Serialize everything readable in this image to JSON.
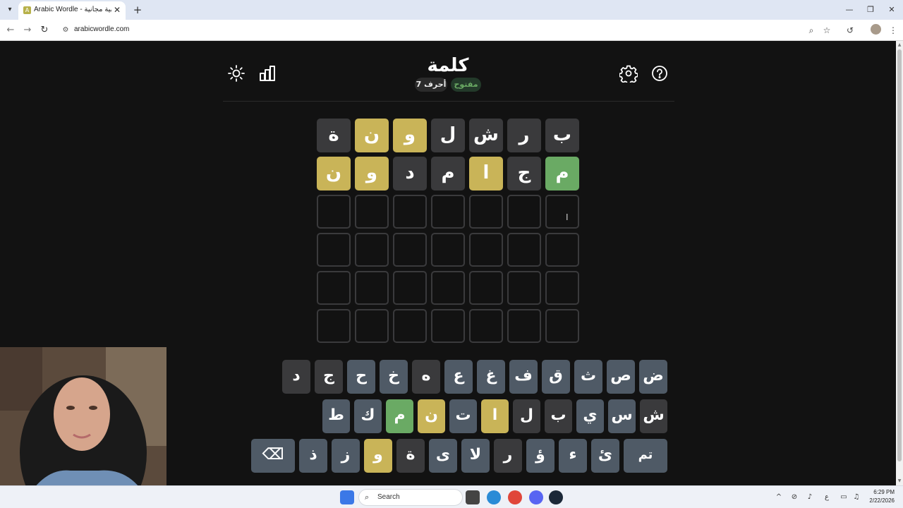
{
  "browser": {
    "tab_title": "Arabic Wordle - كلمة: لعبة كلمات عربية مجانية",
    "url": "arabicwordle.com",
    "icons": [
      "tab-list",
      "close",
      "new-tab",
      "minimize",
      "restore",
      "window-close",
      "back",
      "forward",
      "reload",
      "site-info",
      "zoom",
      "bookmark-star",
      "history",
      "profile",
      "menu"
    ]
  },
  "header": {
    "title": "كلمة",
    "badge_open": "مفتوح",
    "badge_letters": "7 أحرف",
    "icons": [
      "sun-icon",
      "stats-icon",
      "settings-icon",
      "help-icon"
    ]
  },
  "board": {
    "rows": [
      {
        "tiles": [
          {
            "letter": "ب",
            "state": "absent"
          },
          {
            "letter": "ر",
            "state": "absent"
          },
          {
            "letter": "ش",
            "state": "absent"
          },
          {
            "letter": "ل",
            "state": "absent"
          },
          {
            "letter": "و",
            "state": "present"
          },
          {
            "letter": "ن",
            "state": "present"
          },
          {
            "letter": "ة",
            "state": "absent"
          }
        ]
      },
      {
        "tiles": [
          {
            "letter": "م",
            "state": "correct"
          },
          {
            "letter": "ج",
            "state": "absent"
          },
          {
            "letter": "ا",
            "state": "present"
          },
          {
            "letter": "م",
            "state": "absent"
          },
          {
            "letter": "د",
            "state": "absent"
          },
          {
            "letter": "و",
            "state": "present"
          },
          {
            "letter": "ن",
            "state": "present"
          }
        ]
      }
    ],
    "total_rows": 6,
    "columns": 7
  },
  "keyboard": {
    "rows": [
      [
        {
          "key": "ض",
          "state": "default"
        },
        {
          "key": "ص",
          "state": "default"
        },
        {
          "key": "ث",
          "state": "default"
        },
        {
          "key": "ق",
          "state": "default"
        },
        {
          "key": "ف",
          "state": "default"
        },
        {
          "key": "غ",
          "state": "default"
        },
        {
          "key": "ع",
          "state": "default"
        },
        {
          "key": "ه",
          "state": "absent"
        },
        {
          "key": "خ",
          "state": "default"
        },
        {
          "key": "ح",
          "state": "default"
        },
        {
          "key": "ج",
          "state": "absent"
        },
        {
          "key": "د",
          "state": "absent"
        }
      ],
      [
        {
          "key": "ش",
          "state": "absent"
        },
        {
          "key": "س",
          "state": "default"
        },
        {
          "key": "ي",
          "state": "default"
        },
        {
          "key": "ب",
          "state": "absent"
        },
        {
          "key": "ل",
          "state": "absent"
        },
        {
          "key": "ا",
          "state": "present"
        },
        {
          "key": "ت",
          "state": "default"
        },
        {
          "key": "ن",
          "state": "present"
        },
        {
          "key": "م",
          "state": "correct"
        },
        {
          "key": "ك",
          "state": "default"
        },
        {
          "key": "ط",
          "state": "default"
        }
      ],
      [
        {
          "key": "تم",
          "state": "default",
          "kind": "enter"
        },
        {
          "key": "ئ",
          "state": "default"
        },
        {
          "key": "ء",
          "state": "default"
        },
        {
          "key": "ؤ",
          "state": "default"
        },
        {
          "key": "ر",
          "state": "absent"
        },
        {
          "key": "لا",
          "state": "default"
        },
        {
          "key": "ى",
          "state": "default"
        },
        {
          "key": "ة",
          "state": "absent"
        },
        {
          "key": "و",
          "state": "present"
        },
        {
          "key": "ز",
          "state": "default"
        },
        {
          "key": "ذ",
          "state": "default"
        },
        {
          "key": "⌫",
          "state": "default",
          "kind": "backspace"
        }
      ]
    ]
  },
  "taskbar": {
    "search_label": "Search",
    "time": "6:29 PM",
    "date": "2/22/2026",
    "lang": "ع"
  },
  "colors": {
    "absent": "#3a3a3c",
    "present": "#c9b458",
    "correct": "#6aaa64",
    "key_default": "#4f5a66",
    "background": "#121212"
  }
}
